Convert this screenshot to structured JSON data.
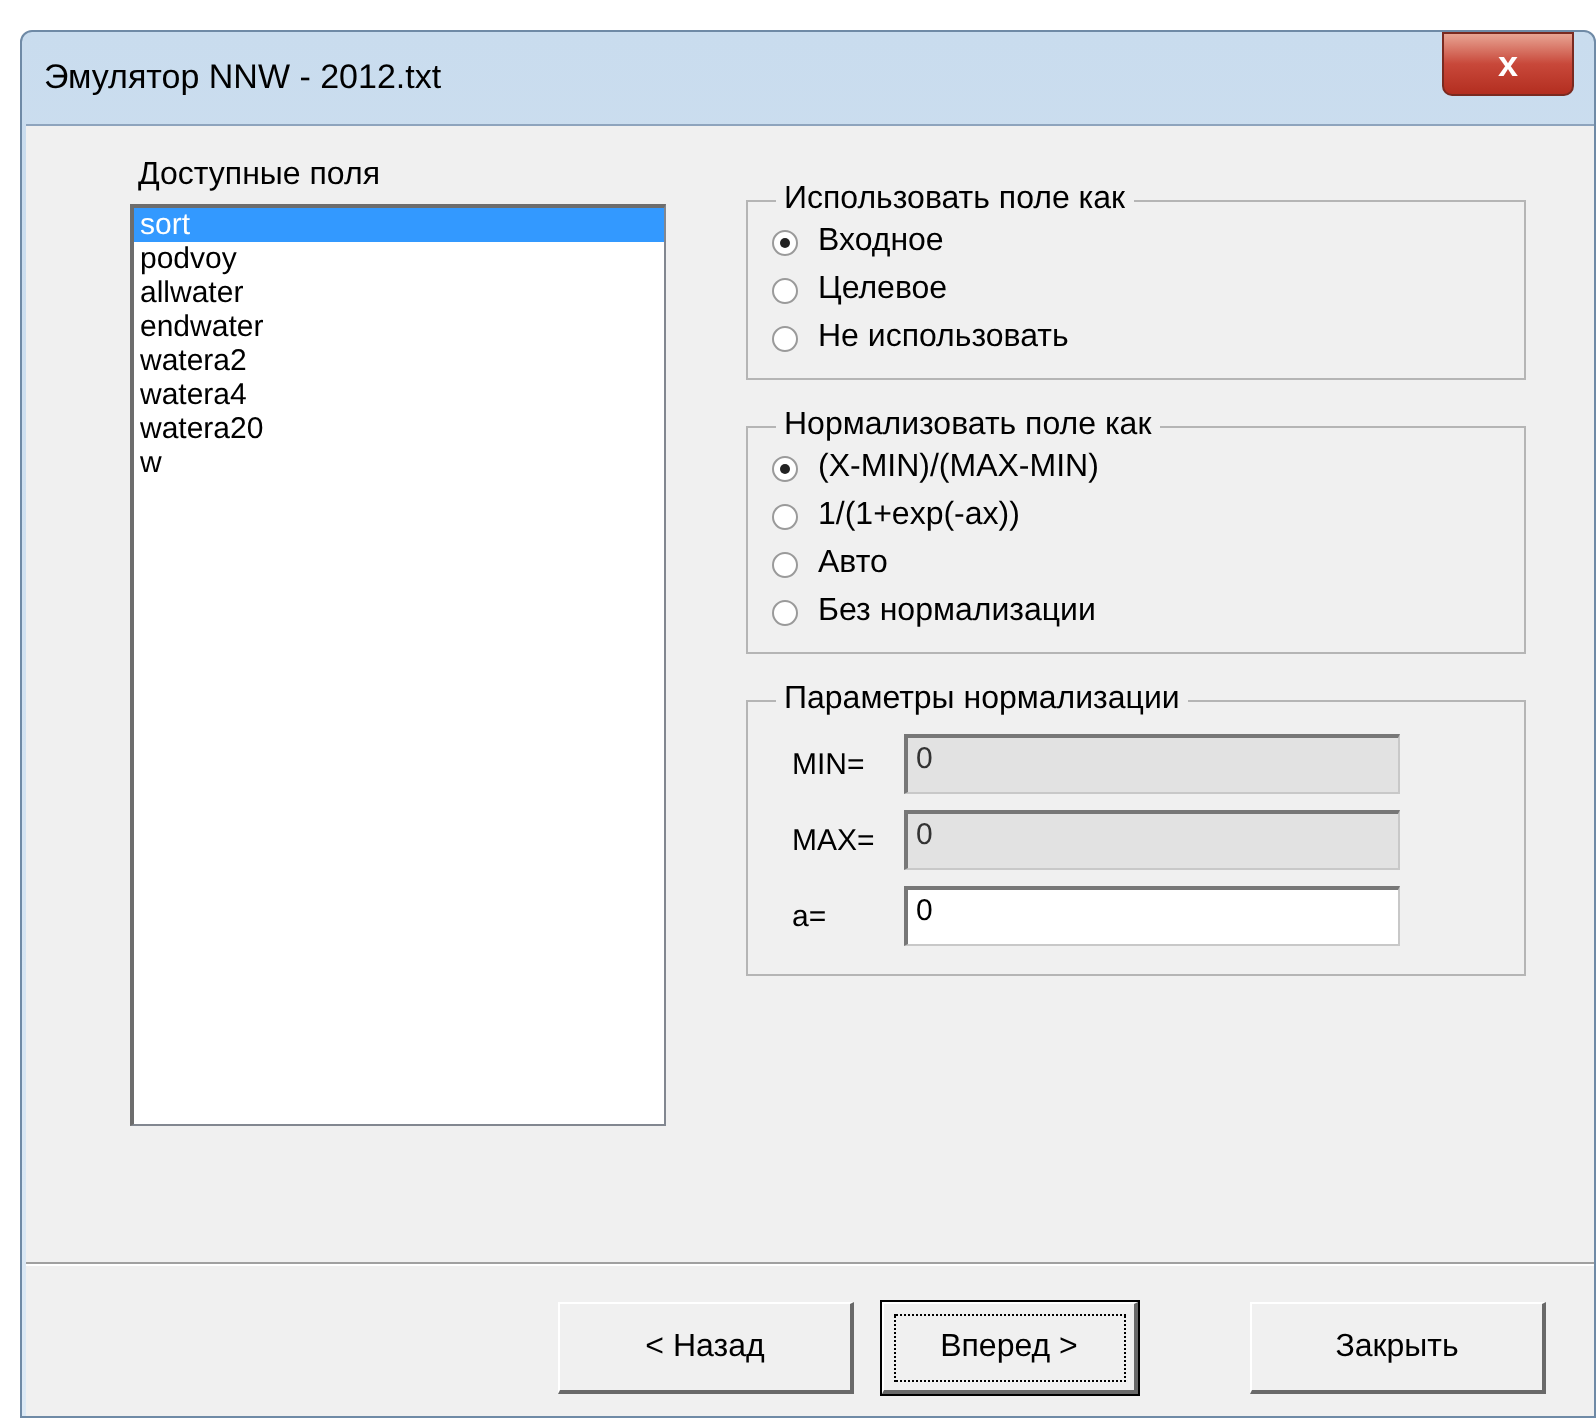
{
  "window": {
    "title": "Эмулятор NNW - 2012.txt",
    "close": "x"
  },
  "fields": {
    "label": "Доступные поля",
    "items": [
      {
        "label": "sort",
        "selected": true
      },
      {
        "label": "podvoy",
        "selected": false
      },
      {
        "label": "allwater",
        "selected": false
      },
      {
        "label": "endwater",
        "selected": false
      },
      {
        "label": "watera2",
        "selected": false
      },
      {
        "label": "watera4",
        "selected": false
      },
      {
        "label": "watera20",
        "selected": false
      },
      {
        "label": "w",
        "selected": false
      }
    ]
  },
  "use_as": {
    "title": "Использовать поле как",
    "options": [
      {
        "label": "Входное",
        "selected": true
      },
      {
        "label": "Целевое",
        "selected": false
      },
      {
        "label": "Не использовать",
        "selected": false
      }
    ]
  },
  "normalize_as": {
    "title": "Нормализовать поле как",
    "options": [
      {
        "label": "(X-MIN)/(MAX-MIN)",
        "selected": true
      },
      {
        "label": "1/(1+exp(-ax))",
        "selected": false
      },
      {
        "label": "Авто",
        "selected": false
      },
      {
        "label": "Без нормализации",
        "selected": false
      }
    ]
  },
  "params": {
    "title": "Параметры нормализации",
    "inputs": [
      {
        "label": "MIN=",
        "value": "0",
        "disabled": true
      },
      {
        "label": "MAX=",
        "value": "0",
        "disabled": true
      },
      {
        "label": "a=",
        "value": "0",
        "disabled": false
      }
    ]
  },
  "buttons": [
    {
      "label": "< Назад",
      "focused": false
    },
    {
      "label": "Вперед >",
      "focused": true
    },
    {
      "label": "Закрыть",
      "focused": false
    }
  ]
}
